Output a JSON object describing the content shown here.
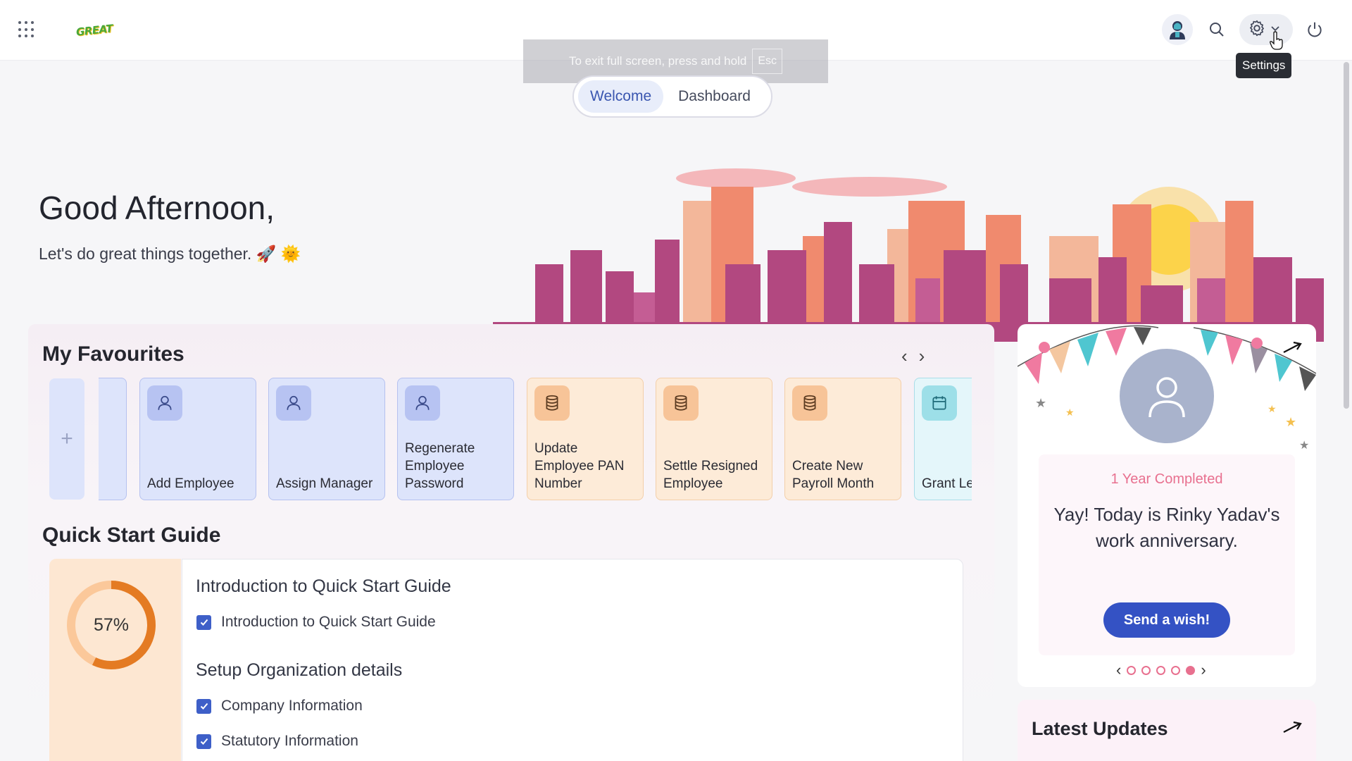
{
  "header": {
    "logo_text": "GREAT",
    "settings_tooltip": "Settings",
    "icons": [
      "apps-grid-icon",
      "user-avatar-icon",
      "search-icon",
      "gear-icon",
      "chevron-down-icon",
      "power-icon"
    ]
  },
  "fullscreen_notice": {
    "text": "To exit full screen, press and hold",
    "key": "Esc"
  },
  "tabs": [
    {
      "label": "Welcome",
      "active": true
    },
    {
      "label": "Dashboard",
      "active": false
    }
  ],
  "greeting": {
    "title": "Good Afternoon,",
    "subtitle": "Let's do great things together. 🚀 🌞"
  },
  "favourites": {
    "title": "My Favourites",
    "add_label": "+",
    "items": [
      {
        "label": "",
        "color": "blue",
        "icon": "user-icon"
      },
      {
        "label": "Add Employee",
        "color": "blue",
        "icon": "user-icon"
      },
      {
        "label": "Assign Manager",
        "color": "blue",
        "icon": "user-icon"
      },
      {
        "label": "Regenerate Employee Password",
        "color": "blue",
        "icon": "user-icon"
      },
      {
        "label": "Update Employee PAN Number",
        "color": "orange",
        "icon": "database-icon"
      },
      {
        "label": "Settle Resigned Employee",
        "color": "orange",
        "icon": "database-icon"
      },
      {
        "label": "Create New Payroll Month",
        "color": "orange",
        "icon": "database-icon"
      },
      {
        "label": "Grant Le",
        "color": "cyan",
        "icon": "calendar-icon"
      }
    ]
  },
  "quick_start": {
    "title": "Quick Start Guide",
    "progress_percent": 57,
    "progress_label": "57%",
    "sections": [
      {
        "heading": "Introduction to Quick Start Guide",
        "items": [
          "Introduction to Quick Start Guide"
        ]
      },
      {
        "heading": "Setup Organization details",
        "items": [
          "Company Information",
          "Statutory Information"
        ]
      }
    ]
  },
  "anniversary": {
    "tag": "1 Year Completed",
    "message": "Yay! Today is Rinky Yadav's work anniversary.",
    "button": "Send a wish!",
    "page_count": 5,
    "active_page": 5
  },
  "latest_updates": {
    "title": "Latest Updates"
  },
  "colors": {
    "accent": "#3452c4",
    "pink": "#e8708f",
    "blue_tile": "#dde4fb",
    "orange_tile": "#fdebd8"
  }
}
